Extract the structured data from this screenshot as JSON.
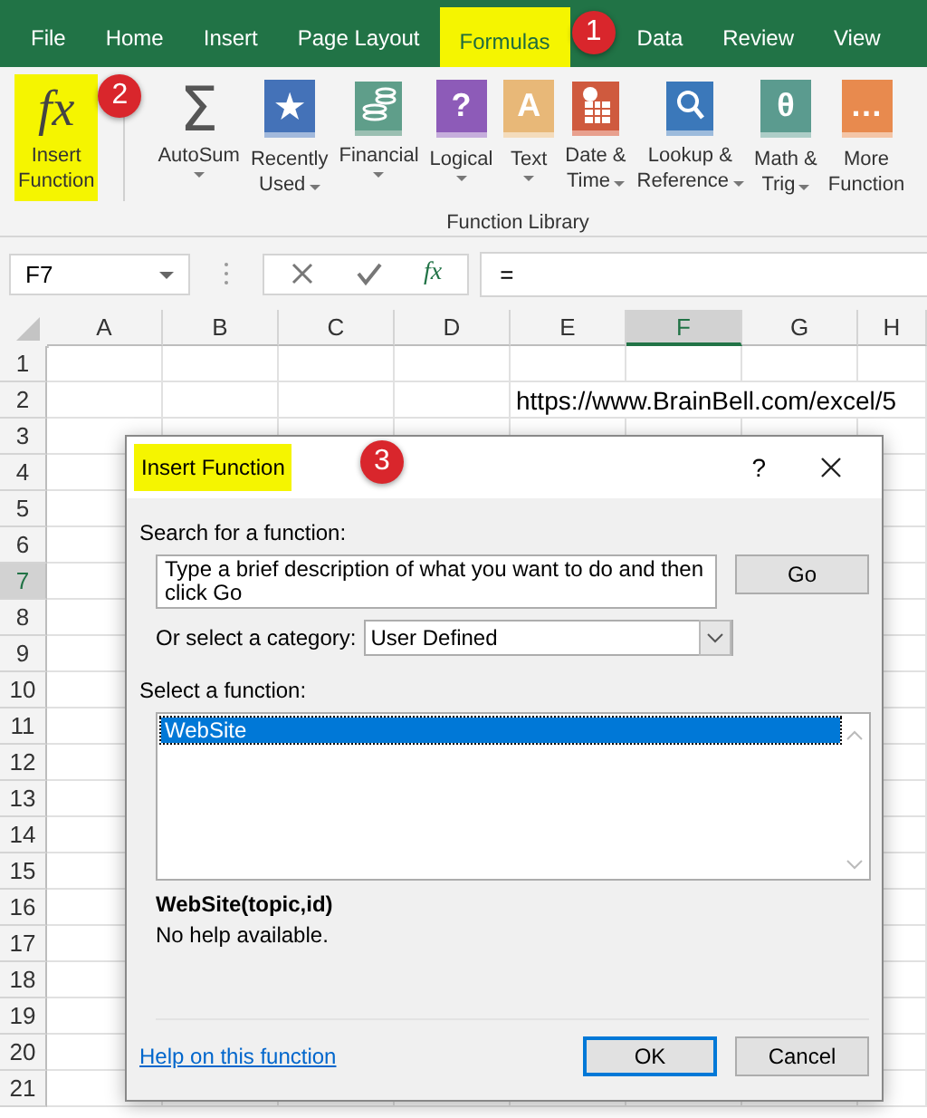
{
  "tabs": [
    {
      "label": "File",
      "selected": false,
      "highlighted": false
    },
    {
      "label": "Home",
      "selected": false,
      "highlighted": false
    },
    {
      "label": "Insert",
      "selected": false,
      "highlighted": false
    },
    {
      "label": "Page Layout",
      "selected": false,
      "highlighted": false
    },
    {
      "label": "Formulas",
      "selected": true,
      "highlighted": true,
      "badge": "1"
    },
    {
      "label": "Data",
      "selected": false,
      "highlighted": false
    },
    {
      "label": "Review",
      "selected": false,
      "highlighted": false
    },
    {
      "label": "View",
      "selected": false,
      "highlighted": false
    }
  ],
  "ribbon": {
    "items": [
      {
        "kind": "symbol",
        "glyph": "fx",
        "lines": [
          "Insert",
          "Function"
        ],
        "dropdown": false,
        "highlighted": true,
        "badge": "2"
      },
      {
        "kind": "symbol",
        "glyph": "Σ",
        "lines": [
          "AutoSum"
        ],
        "dropdown": true,
        "highlighted": false
      },
      {
        "kind": "book",
        "glyph": "★",
        "color": "#4472b8",
        "lines": [
          "Recently",
          "Used"
        ],
        "dropdown": true,
        "highlighted": false
      },
      {
        "kind": "coins",
        "color": "#5f9e8a",
        "lines": [
          "Financial"
        ],
        "dropdown": true,
        "highlighted": false
      },
      {
        "kind": "book",
        "glyph": "?",
        "color": "#8d5bb8",
        "lines": [
          "Logical"
        ],
        "dropdown": true,
        "highlighted": false
      },
      {
        "kind": "book",
        "glyph": "A",
        "color": "#e8b878",
        "lines": [
          "Text"
        ],
        "dropdown": true,
        "highlighted": false
      },
      {
        "kind": "calendar",
        "color": "#cf5a3e",
        "lines": [
          "Date &",
          "Time"
        ],
        "dropdown": true,
        "highlighted": false
      },
      {
        "kind": "magnifier",
        "color": "#3b78ba",
        "lines": [
          "Lookup &",
          "Reference"
        ],
        "dropdown": true,
        "highlighted": false
      },
      {
        "kind": "book",
        "glyph": "θ",
        "color": "#5b9b8f",
        "lines": [
          "Math &",
          "Trig"
        ],
        "dropdown": true,
        "highlighted": false
      },
      {
        "kind": "book",
        "glyph": "…",
        "color": "#e88a4e",
        "lines": [
          "More",
          "Function"
        ],
        "dropdown": false,
        "highlighted": false
      }
    ],
    "group_label": "Function Library"
  },
  "formula_bar": {
    "name_box": "F7",
    "fx": "fx",
    "value": "="
  },
  "sheet": {
    "columns": [
      {
        "label": "A",
        "selected": false
      },
      {
        "label": "B",
        "selected": false
      },
      {
        "label": "C",
        "selected": false
      },
      {
        "label": "D",
        "selected": false
      },
      {
        "label": "E",
        "selected": false
      },
      {
        "label": "F",
        "selected": true
      },
      {
        "label": "G",
        "selected": false
      },
      {
        "label": "H",
        "selected": false
      }
    ],
    "rows": [
      {
        "label": "1",
        "selected": false
      },
      {
        "label": "2",
        "selected": false,
        "text": "https://www.BrainBell.com/excel/5"
      },
      {
        "label": "3",
        "selected": false
      },
      {
        "label": "4",
        "selected": false
      },
      {
        "label": "5",
        "selected": false
      },
      {
        "label": "6",
        "selected": false
      },
      {
        "label": "7",
        "selected": true
      },
      {
        "label": "8",
        "selected": false
      },
      {
        "label": "9",
        "selected": false
      },
      {
        "label": "10",
        "selected": false
      },
      {
        "label": "11",
        "selected": false
      },
      {
        "label": "12",
        "selected": false
      },
      {
        "label": "13",
        "selected": false
      },
      {
        "label": "14",
        "selected": false
      },
      {
        "label": "15",
        "selected": false
      },
      {
        "label": "16",
        "selected": false
      },
      {
        "label": "17",
        "selected": false
      },
      {
        "label": "18",
        "selected": false
      },
      {
        "label": "19",
        "selected": false
      },
      {
        "label": "20",
        "selected": false
      },
      {
        "label": "21",
        "selected": false
      }
    ]
  },
  "dialog": {
    "title": "Insert Function",
    "highlighted": true,
    "badge": "3",
    "help": "?",
    "search_label": "Search for a function:",
    "search_value": "Type a brief description of what you want to do and then click Go",
    "go_button": "Go",
    "category_label": "Or select a category:",
    "category_value": "User Defined",
    "function_label": "Select a function:",
    "functions": [
      {
        "name": "WebSite",
        "selected": true
      }
    ],
    "signature": "WebSite(topic,id)",
    "description": "No help available.",
    "help_link": "Help on this function",
    "buttons": [
      {
        "label": "OK",
        "default": true
      },
      {
        "label": "Cancel",
        "default": false
      }
    ]
  }
}
